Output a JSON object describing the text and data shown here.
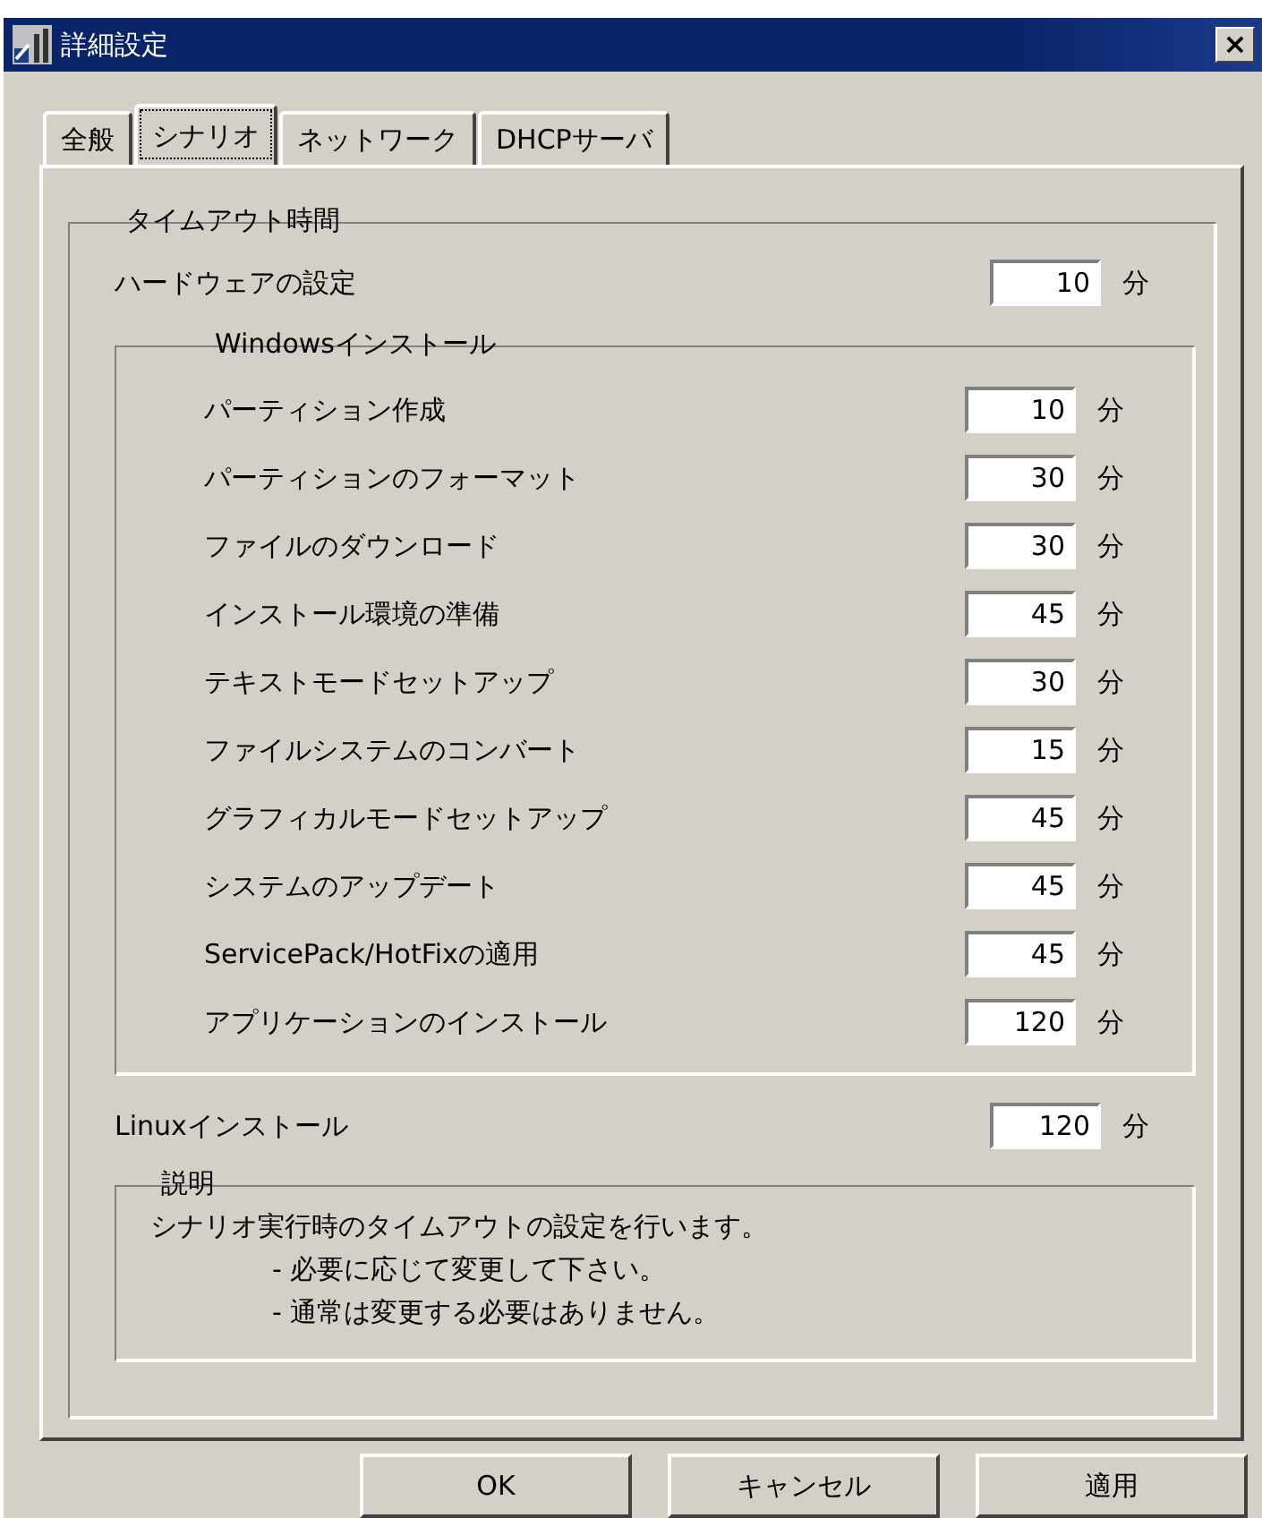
{
  "window": {
    "title": "詳細設定",
    "close": "×"
  },
  "tabs": [
    {
      "label": "全般",
      "selected": false
    },
    {
      "label": "シナリオ",
      "selected": true
    },
    {
      "label": "ネットワーク",
      "selected": false
    },
    {
      "label": "DHCPサーバ",
      "selected": false
    }
  ],
  "timeout_group": {
    "label": "タイムアウト時間",
    "hardware": {
      "label": "ハードウェアの設定",
      "value": "10",
      "unit": "分"
    },
    "windows_group": {
      "label": "Windowsインストール",
      "rows": [
        {
          "label": "パーティション作成",
          "value": "10",
          "unit": "分"
        },
        {
          "label": "パーティションのフォーマット",
          "value": "30",
          "unit": "分"
        },
        {
          "label": "ファイルのダウンロード",
          "value": "30",
          "unit": "分"
        },
        {
          "label": "インストール環境の準備",
          "value": "45",
          "unit": "分"
        },
        {
          "label": "テキストモードセットアップ",
          "value": "30",
          "unit": "分"
        },
        {
          "label": "ファイルシステムのコンバート",
          "value": "15",
          "unit": "分"
        },
        {
          "label": "グラフィカルモードセットアップ",
          "value": "45",
          "unit": "分"
        },
        {
          "label": "システムのアップデート",
          "value": "45",
          "unit": "分"
        },
        {
          "label": "ServicePack/HotFixの適用",
          "value": "45",
          "unit": "分"
        },
        {
          "label": "アプリケーションのインストール",
          "value": "120",
          "unit": "分"
        }
      ]
    },
    "linux": {
      "label": "Linuxインストール",
      "value": "120",
      "unit": "分"
    },
    "description": {
      "label": "説明",
      "lines": [
        "シナリオ実行時のタイムアウトの設定を行います。",
        "- 必要に応じて変更して下さい。",
        "- 通常は変更する必要はありません。"
      ]
    }
  },
  "buttons": [
    "OK",
    "キャンセル",
    "適用"
  ]
}
